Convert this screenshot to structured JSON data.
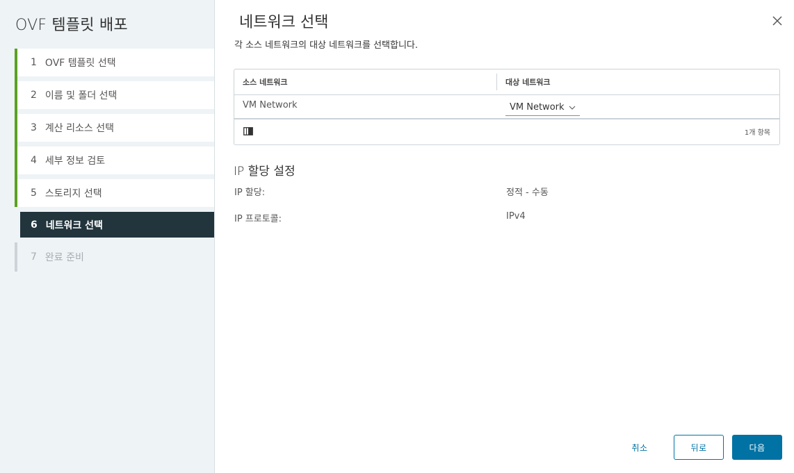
{
  "wizard": {
    "title": "OVF 템플릿 배포",
    "steps": [
      {
        "num": "1",
        "label": "OVF 템플릿 선택",
        "state": "done"
      },
      {
        "num": "2",
        "label": "이름 및 폴더 선택",
        "state": "done"
      },
      {
        "num": "3",
        "label": "계산 리소스 선택",
        "state": "done"
      },
      {
        "num": "4",
        "label": "세부 정보 검토",
        "state": "done"
      },
      {
        "num": "5",
        "label": "스토리지 선택",
        "state": "done"
      },
      {
        "num": "6",
        "label": "네트워크 선택",
        "state": "active"
      },
      {
        "num": "7",
        "label": "완료 준비",
        "state": "future"
      }
    ]
  },
  "page": {
    "title": "네트워크 선택",
    "description": "각 소스 네트워크의 대상 네트워크를 선택합니다."
  },
  "grid": {
    "columns": [
      "소스 네트워크",
      "대상 네트워크"
    ],
    "rows": [
      {
        "source": "VM Network",
        "destination": "VM Network"
      }
    ],
    "footer_count": "1개 항목"
  },
  "ip_settings": {
    "title": "IP 할당 설정",
    "allocation_label": "IP 할당:",
    "allocation_value": "정적 - 수동",
    "protocol_label": "IP 프로토콜:",
    "protocol_value": "IPv4"
  },
  "buttons": {
    "cancel": "취소",
    "back": "뒤로",
    "next": "다음"
  },
  "colors": {
    "accent": "#0072a3",
    "done_green": "#5aa220",
    "active_bg": "#22343c",
    "sidebar_bg": "#eef3f6"
  },
  "icons": {
    "close": "close-icon",
    "dropdown": "chevron-down-icon",
    "column_toggle": "column-toggle-icon"
  }
}
